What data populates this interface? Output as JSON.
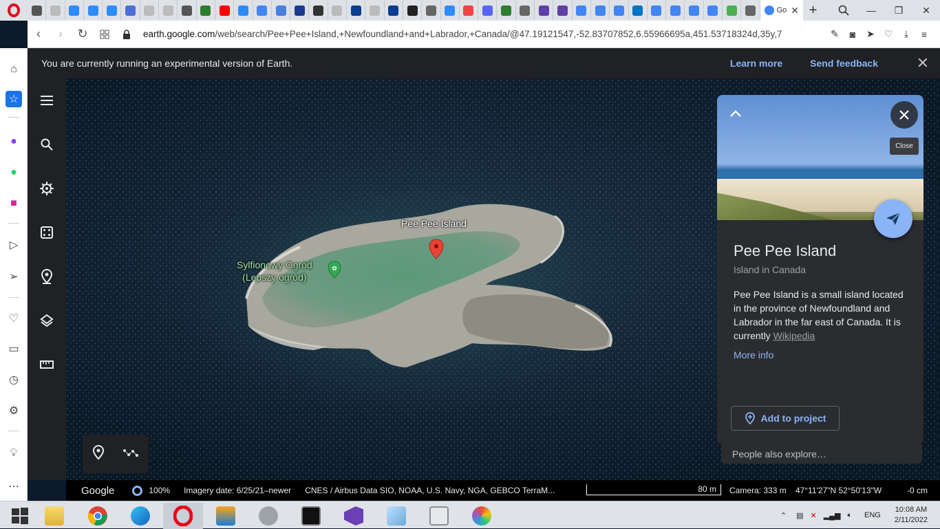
{
  "browser": {
    "active_tab_label": "Go",
    "url_host": "earth.google.com",
    "url_path": "/web/search/Pee+Pee+Island,+Newfoundland+and+Labrador,+Canada/@47.19121547,-52.83707852,6.55966695a,451.53718324d,35y,7",
    "tab_favicons": [
      "#555",
      "#bbb",
      "#2d8cff",
      "#2d8cff",
      "#2d8cff",
      "#4a70d8",
      "#bbb",
      "#bbb",
      "#555",
      "#2e7d32",
      "#ff0000",
      "#2d8cff",
      "#4285f4",
      "#4a7fe0",
      "#1a3a8f",
      "#333",
      "#bbb",
      "#0b3d91",
      "#bbb",
      "#0b3d91",
      "#222",
      "#666",
      "#2d8cff",
      "#e44",
      "#5865f2",
      "#2e7d32",
      "#666",
      "#5f3fa8",
      "#5f3fa8",
      "#4285f4",
      "#4285f4",
      "#4285f4",
      "#0071c5",
      "#4285f4",
      "#4285f4",
      "#4285f4",
      "#4285f4",
      "#4caf50",
      "#666"
    ]
  },
  "banner": {
    "message": "You are currently running an experimental version of Earth.",
    "learn_more": "Learn more",
    "send_feedback": "Send feedback"
  },
  "map": {
    "place_label": "Pee Pee Island",
    "poi_label_line1": "Sylfionowy Ogród",
    "poi_label_line2": "(Lepszy ogród)"
  },
  "status": {
    "logo": "Google",
    "percent": "100%",
    "imagery_date": "Imagery date: 6/25/21–newer",
    "credits": "CNES / Airbus   Data SIO, NOAA, U.S. Navy, NGA, GEBCO   TerraM...",
    "scale_label": "80 m",
    "camera": "Camera: 333 m",
    "coords": "47°11'27\"N 52°50'13\"W",
    "elevation": "-0 cm"
  },
  "panel": {
    "title": "Pee Pee Island",
    "subtitle": "Island in Canada",
    "description": "Pee Pee Island is a small island located in the province of Newfoundland and Labrador in the far east of Canada. It is currently",
    "wiki_link": "Wikipedia",
    "more_info": "More info",
    "add_to_project": "Add to project",
    "close_tooltip": "Close",
    "people_also_explore": "People also explore…"
  },
  "taskbar": {
    "time": "10:08 AM",
    "date": "2/11/2022",
    "lang": "ENG"
  }
}
